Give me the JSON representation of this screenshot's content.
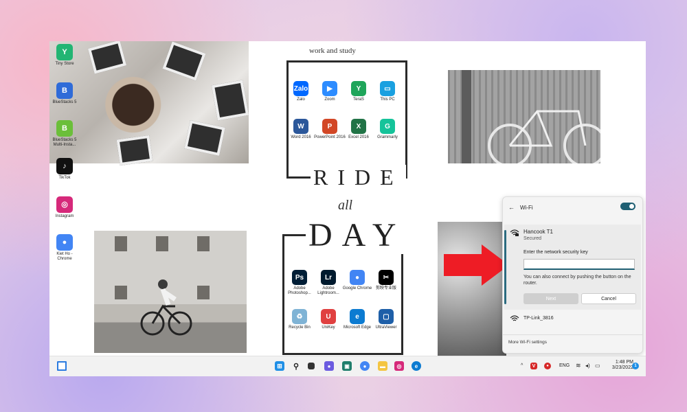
{
  "desktop_icons": [
    {
      "label": "Tiny Store",
      "color": "#22b573",
      "glyph": "Y"
    },
    {
      "label": "BlueStacks 5",
      "color": "#2f6bd8",
      "glyph": "B"
    },
    {
      "label": "BlueStacks 5 Multi-Insta...",
      "color": "#6bbf3a",
      "glyph": "B"
    },
    {
      "label": "TikTok",
      "color": "#111111",
      "glyph": "♪"
    },
    {
      "label": "Instagram",
      "color": "#d6297a",
      "glyph": "◎"
    },
    {
      "label": "Kiet Ho - Chrome",
      "color": "#4285f4",
      "glyph": "●"
    }
  ],
  "wallpaper": {
    "caption": "work and study",
    "ride": "RIDE",
    "all": "all",
    "day": "DAY"
  },
  "frame1_apps": [
    {
      "label": "Zalo",
      "color": "#0068ff",
      "glyph": "Zalo"
    },
    {
      "label": "Zoom",
      "color": "#2d8cff",
      "glyph": "▶"
    },
    {
      "label": "TeraS",
      "color": "#1fa55a",
      "glyph": "Y"
    },
    {
      "label": "This PC",
      "color": "#1aa0e0",
      "glyph": "▭"
    },
    {
      "label": "Word 2016",
      "color": "#2b579a",
      "glyph": "W"
    },
    {
      "label": "PowerPoint 2016",
      "color": "#d24726",
      "glyph": "P"
    },
    {
      "label": "Excel 2016",
      "color": "#217346",
      "glyph": "X"
    },
    {
      "label": "Grammarly",
      "color": "#15c39a",
      "glyph": "G"
    }
  ],
  "frame2_apps": [
    {
      "label": "Adobe Photoshop...",
      "color": "#001e36",
      "glyph": "Ps"
    },
    {
      "label": "Adobe Lightroom...",
      "color": "#001a2e",
      "glyph": "Lr"
    },
    {
      "label": "Google Chrome",
      "color": "#4285f4",
      "glyph": "●"
    },
    {
      "label": "剪映专业版",
      "color": "#000000",
      "glyph": "✂"
    },
    {
      "label": "Recycle Bin",
      "color": "#7fb3d5",
      "glyph": "♻"
    },
    {
      "label": "UniKey",
      "color": "#e04040",
      "glyph": "U"
    },
    {
      "label": "Microsoft Edge",
      "color": "#0c7bd1",
      "glyph": "e"
    },
    {
      "label": "UltraViewer",
      "color": "#1e5fa8",
      "glyph": "▢"
    }
  ],
  "wifi_panel": {
    "title": "Wi-Fi",
    "back_icon": "←",
    "toggle_on": true,
    "network_name": "Hancook T1",
    "network_status": "Secured",
    "key_prompt": "Enter the network security key",
    "key_value": "",
    "hint": "You can also connect by pushing the button on the router.",
    "next_label": "Next",
    "cancel_label": "Cancel",
    "other_network": "TP-Link_3816",
    "more_settings": "More Wi-Fi settings"
  },
  "arrow_color": "#ee1c25",
  "taskbar": {
    "lang": "ENG",
    "time": "1:48 PM",
    "date": "3/23/2022",
    "notif_count": "1"
  }
}
